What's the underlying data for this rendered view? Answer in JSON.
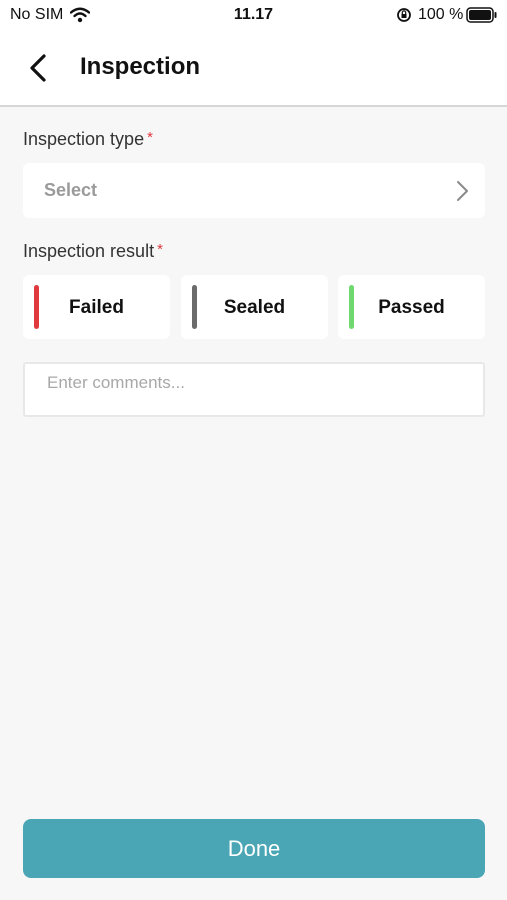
{
  "status_bar": {
    "carrier": "No SIM",
    "time": "11.17",
    "battery": "100 %",
    "icons": [
      "wifi-icon",
      "orientation-lock-icon",
      "battery-icon"
    ]
  },
  "nav": {
    "title": "Inspection",
    "back_icon": "chevron-left-icon"
  },
  "form": {
    "inspection_type": {
      "label": "Inspection type",
      "required_mark": "*",
      "placeholder": "Select"
    },
    "inspection_result": {
      "label": "Inspection result",
      "required_mark": "*",
      "options": [
        {
          "label": "Failed",
          "color": "#e0393e"
        },
        {
          "label": "Sealed",
          "color": "#6b6b6b"
        },
        {
          "label": "Passed",
          "color": "#6fd86f"
        }
      ]
    },
    "comments": {
      "placeholder": "Enter comments...",
      "value": ""
    }
  },
  "actions": {
    "done_label": "Done"
  },
  "colors": {
    "accent": "#4aa6b4",
    "required": "#e0393e",
    "background": "#f7f7f8"
  }
}
